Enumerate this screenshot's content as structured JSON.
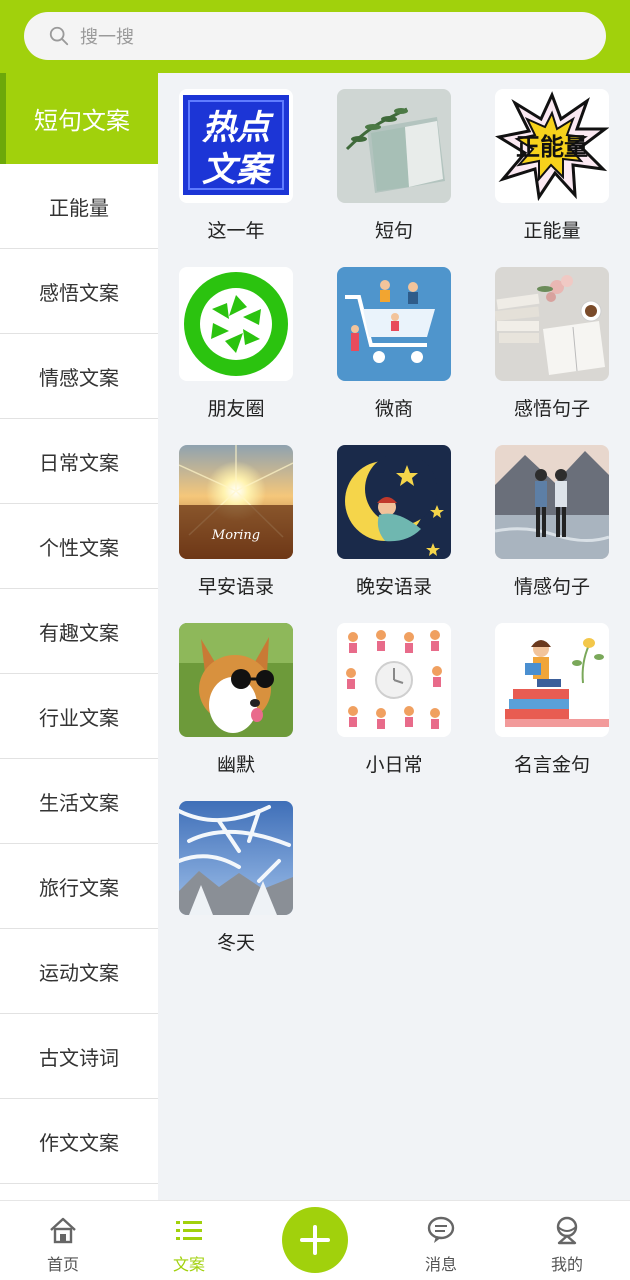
{
  "search": {
    "placeholder": "搜一搜"
  },
  "sidebar": {
    "items": [
      {
        "label": "短句文案",
        "active": true
      },
      {
        "label": "正能量"
      },
      {
        "label": "感悟文案"
      },
      {
        "label": "情感文案"
      },
      {
        "label": "日常文案"
      },
      {
        "label": "个性文案"
      },
      {
        "label": "有趣文案"
      },
      {
        "label": "行业文案"
      },
      {
        "label": "生活文案"
      },
      {
        "label": "旅行文案"
      },
      {
        "label": "运动文案"
      },
      {
        "label": "古文诗词"
      },
      {
        "label": "作文文案"
      }
    ]
  },
  "grid": {
    "tiles": [
      {
        "label": "这一年",
        "thumb": "hot-copy-logo-thumb",
        "thumb_text": "热点文案"
      },
      {
        "label": "短句",
        "thumb": "book-plant-thumb"
      },
      {
        "label": "正能量",
        "thumb": "comic-burst-thumb",
        "thumb_text": "正能量"
      },
      {
        "label": "朋友圈",
        "thumb": "camera-aperture-thumb"
      },
      {
        "label": "微商",
        "thumb": "shopping-cart-people-thumb"
      },
      {
        "label": "感悟句子",
        "thumb": "books-coffee-thumb"
      },
      {
        "label": "早安语录",
        "thumb": "sunrise-thumb",
        "thumb_text": "Moring"
      },
      {
        "label": "晚安语录",
        "thumb": "moon-sleeping-girl-thumb"
      },
      {
        "label": "情感句子",
        "thumb": "couple-walking-thumb"
      },
      {
        "label": "幽默",
        "thumb": "corgi-sunglasses-thumb"
      },
      {
        "label": "小日常",
        "thumb": "daily-routine-clock-thumb"
      },
      {
        "label": "名言金句",
        "thumb": "girl-reading-books-thumb"
      },
      {
        "label": "冬天",
        "thumb": "snowy-trees-thumb"
      }
    ]
  },
  "bottom_nav": {
    "items": [
      {
        "label": "首页",
        "icon": "home-icon"
      },
      {
        "label": "文案",
        "icon": "list-icon",
        "active": true
      },
      {
        "label": "",
        "icon": "plus-icon"
      },
      {
        "label": "消息",
        "icon": "message-icon"
      },
      {
        "label": "我的",
        "icon": "profile-icon"
      }
    ]
  },
  "colors": {
    "accent": "#a1d10c",
    "background": "#f1f3f6",
    "sidebar_bg": "#ffffff"
  }
}
